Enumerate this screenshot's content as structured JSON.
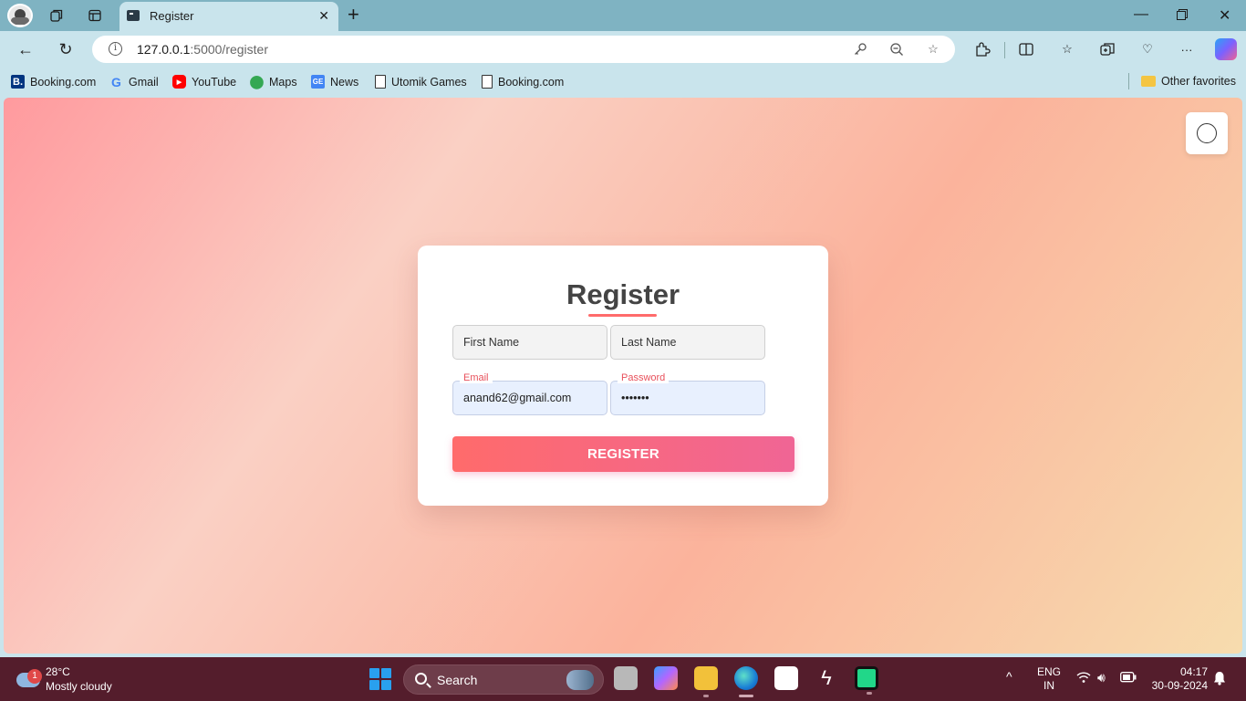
{
  "browser": {
    "tab_title": "Register",
    "url_host": "127.0.0.1",
    "url_path": ":5000/register",
    "favorites": [
      {
        "label": "Booking.com",
        "icon": "booking-icon"
      },
      {
        "label": "Gmail",
        "icon": "google-icon"
      },
      {
        "label": "YouTube",
        "icon": "youtube-icon"
      },
      {
        "label": "Maps",
        "icon": "maps-pin-icon"
      },
      {
        "label": "News",
        "icon": "news-icon"
      },
      {
        "label": "Utomik Games",
        "icon": "page-icon"
      },
      {
        "label": "Booking.com",
        "icon": "page-icon"
      }
    ],
    "other_favorites": "Other favorites"
  },
  "page": {
    "heading": "Register",
    "first_name_placeholder": "First Name",
    "last_name_placeholder": "Last Name",
    "email_label": "Email",
    "email_value": "anand62@gmail.com",
    "password_label": "Password",
    "password_value": "anand62",
    "register_button": "REGISTER",
    "accent_color": "#ff6b6b",
    "button_gradient_end": "#f06595"
  },
  "taskbar": {
    "weather_badge": "1",
    "weather_temp": "28°C",
    "weather_condition": "Mostly cloudy",
    "search_label": "Search",
    "language_line1": "ENG",
    "language_line2": "IN",
    "time": "04:17",
    "date": "30-09-2024"
  }
}
